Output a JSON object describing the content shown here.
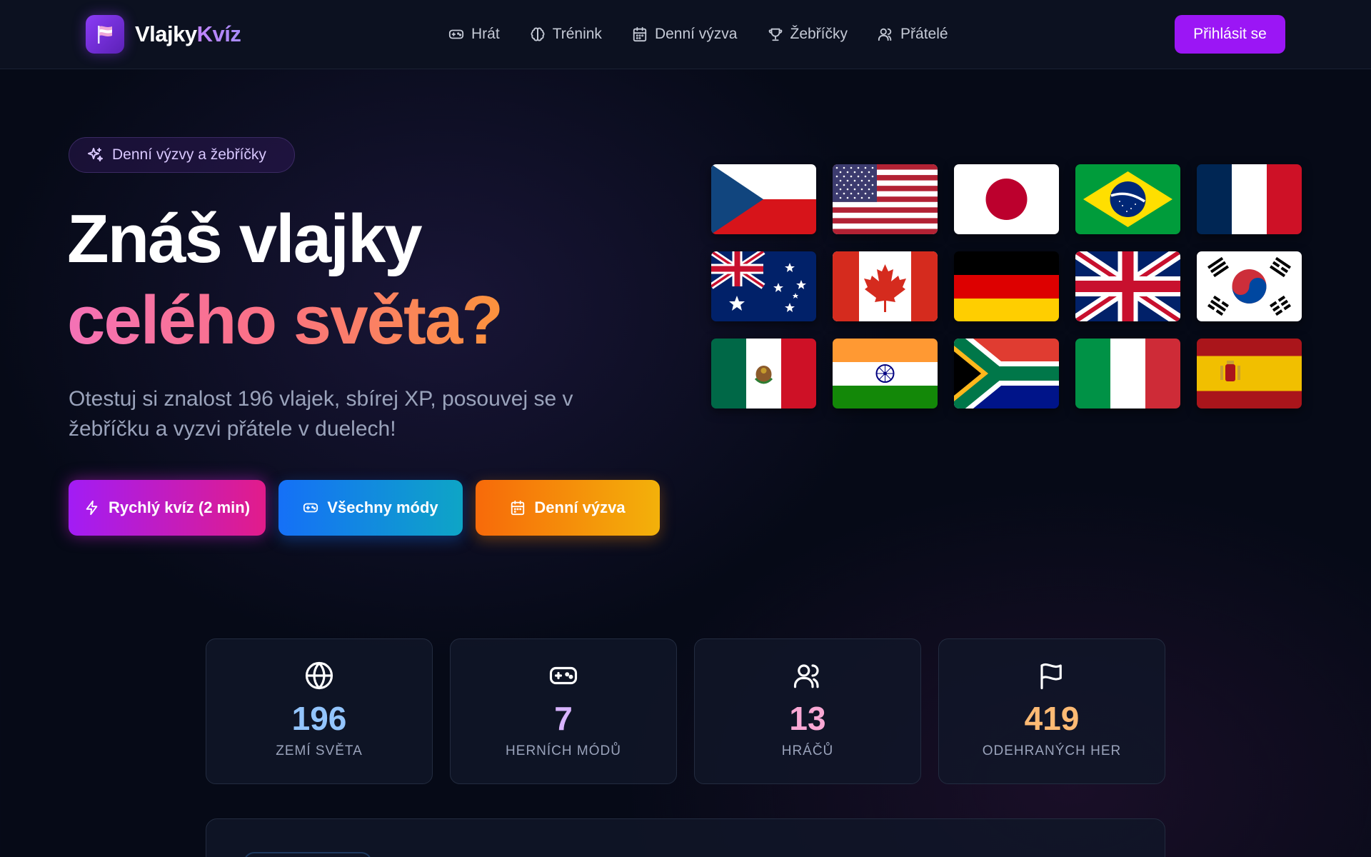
{
  "header": {
    "logo_part1": "Vlajky",
    "logo_part2": "Kvíz",
    "nav": [
      {
        "label": "Hrát",
        "icon": "gamepad-icon"
      },
      {
        "label": "Trénink",
        "icon": "brain-icon"
      },
      {
        "label": "Denní výzva",
        "icon": "calendar-icon"
      },
      {
        "label": "Žebříčky",
        "icon": "trophy-icon"
      },
      {
        "label": "Přátelé",
        "icon": "users-icon"
      }
    ],
    "login_label": "Přihlásit se"
  },
  "hero": {
    "pill": "Denní výzvy a žebříčky",
    "title_line1": "Znáš vlajky",
    "title_line2": "celého světa?",
    "subtitle": "Otestuj si znalost 196 vlajek, sbírej XP, posouvej se v žebříčku a vyzvi přátele v duelech!",
    "buttons": [
      {
        "label": "Rychlý kvíz (2 min)",
        "icon": "lightning-icon"
      },
      {
        "label": "Všechny módy",
        "icon": "gamepad-icon"
      },
      {
        "label": "Denní výzva",
        "icon": "calendar-icon"
      }
    ]
  },
  "flags": [
    "czech-republic",
    "united-states",
    "japan",
    "brazil",
    "france",
    "australia",
    "canada",
    "germany",
    "united-kingdom",
    "south-korea",
    "mexico",
    "india",
    "south-africa",
    "italy",
    "spain"
  ],
  "stats": [
    {
      "value": "196",
      "label": "ZEMÍ SVĚTA",
      "icon": "globe-icon",
      "color": "#93c5fd"
    },
    {
      "value": "7",
      "label": "HERNÍCH MÓDŮ",
      "icon": "gamepad-icon",
      "color": "#d8b4fe"
    },
    {
      "value": "13",
      "label": "HRÁČŮ",
      "icon": "users-icon",
      "color": "#f9a8d4"
    },
    {
      "value": "419",
      "label": "ODEHRANÝCH HER",
      "icon": "flag-icon",
      "color": "#fdba74"
    }
  ],
  "colors": {
    "login": "#9b16f5",
    "accent_purple": "#a21cf5",
    "accent_blue": "#1570f7",
    "accent_orange": "#f76a0a"
  }
}
